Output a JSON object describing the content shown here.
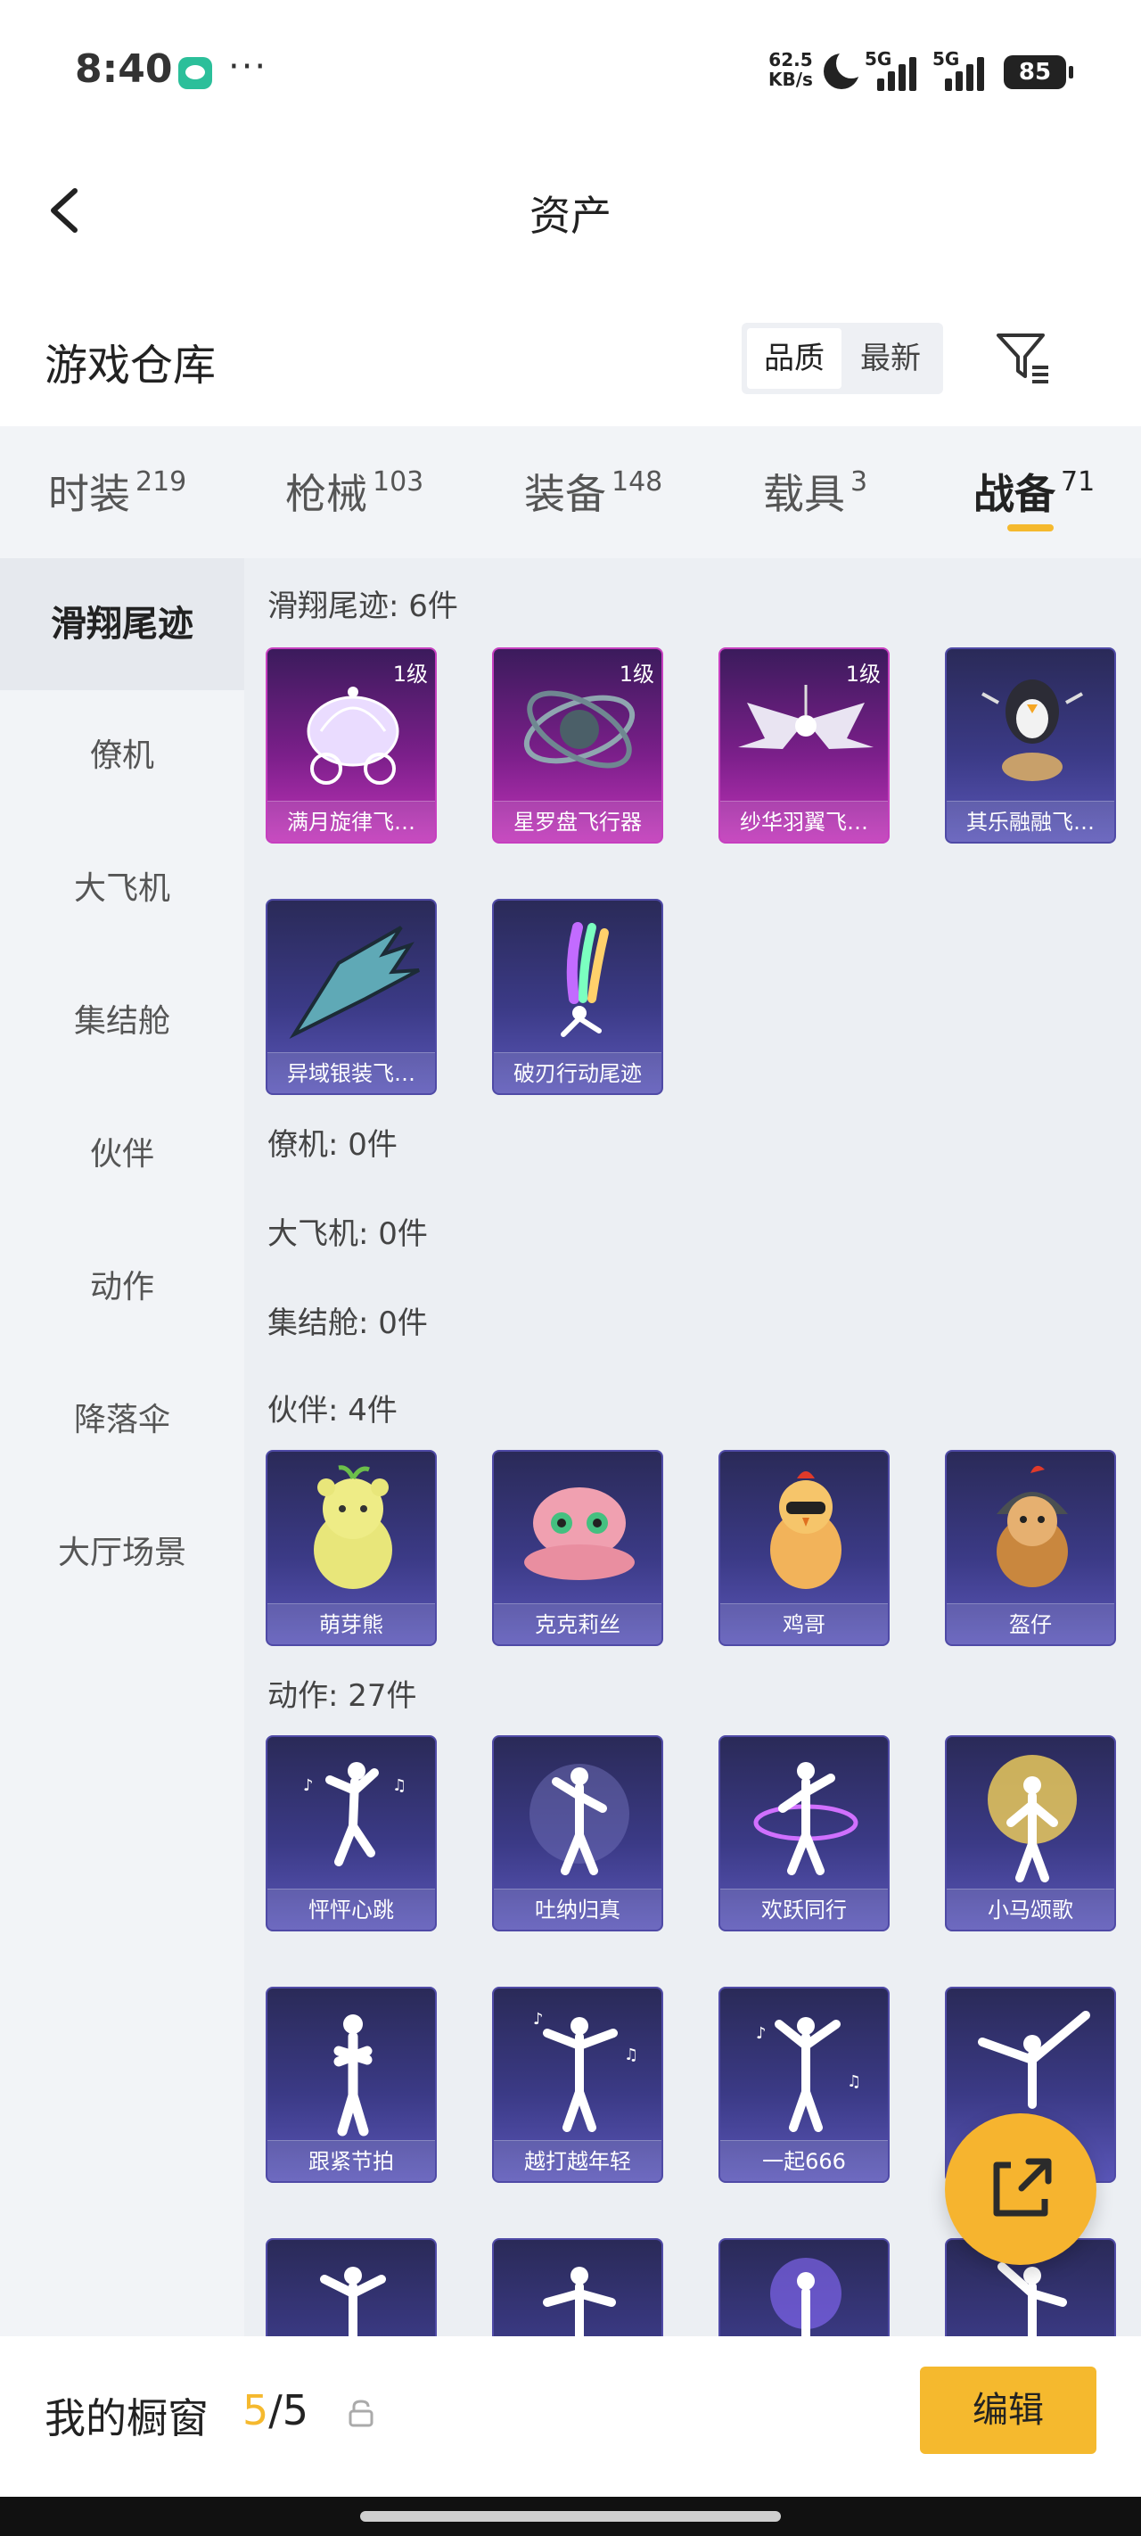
{
  "status_bar": {
    "time": "8:40",
    "dots": "···",
    "net_speed_value": "62.5",
    "net_speed_unit": "KB/s",
    "sim1_label": "5G",
    "sim2_label": "5G",
    "battery": "85"
  },
  "nav": {
    "title": "资产"
  },
  "warehouse": {
    "title": "游戏仓库",
    "sort_options": [
      "品质",
      "最新"
    ],
    "active_sort": "品质"
  },
  "tabs": [
    {
      "label": "时装",
      "count": "219"
    },
    {
      "label": "枪械",
      "count": "103"
    },
    {
      "label": "装备",
      "count": "148"
    },
    {
      "label": "载具",
      "count": "3"
    },
    {
      "label": "战备",
      "count": "71",
      "active": true
    }
  ],
  "sidebar": {
    "items": [
      "滑翔尾迹",
      "僚机",
      "大飞机",
      "集结舱",
      "伙伴",
      "动作",
      "降落伞",
      "大厅场景"
    ],
    "active": "滑翔尾迹"
  },
  "sections": {
    "glide": {
      "title": "滑翔尾迹: 6件",
      "items": [
        {
          "name": "满月旋律飞…",
          "level": "1级",
          "rarity": "pink"
        },
        {
          "name": "星罗盘飞行器",
          "level": "1级",
          "rarity": "pink"
        },
        {
          "name": "纱华羽翼飞…",
          "level": "1级",
          "rarity": "pink"
        },
        {
          "name": "其乐融融飞…",
          "level": "",
          "rarity": "blue"
        },
        {
          "name": "异域银装飞…",
          "level": "",
          "rarity": "blue"
        },
        {
          "name": "破刃行动尾迹",
          "level": "",
          "rarity": "blue"
        }
      ]
    },
    "wingman": {
      "title": "僚机: 0件"
    },
    "plane": {
      "title": "大飞机: 0件"
    },
    "pod": {
      "title": "集结舱: 0件"
    },
    "partner": {
      "title": "伙伴: 4件",
      "items": [
        "萌芽熊",
        "克克莉丝",
        "鸡哥",
        "盔仔"
      ]
    },
    "emote": {
      "title": "动作: 27件",
      "items": [
        "怦怦心跳",
        "吐纳归真",
        "欢跃同行",
        "小马颂歌",
        "跟紧节拍",
        "越打越年轻",
        "一起666"
      ]
    }
  },
  "bottom_bar": {
    "label": "我的橱窗",
    "current": "5",
    "separator": "/",
    "total": "5",
    "edit_label": "编辑"
  },
  "colors": {
    "accent": "#f5b92e",
    "card_blue": "#3b3a86",
    "card_pink": "#c033b8",
    "panel_bg": "#f2f4f7"
  },
  "icons": {
    "back": "chevron-left-icon",
    "filter": "filter-icon",
    "lock": "lock-icon",
    "share": "share-external-icon"
  }
}
